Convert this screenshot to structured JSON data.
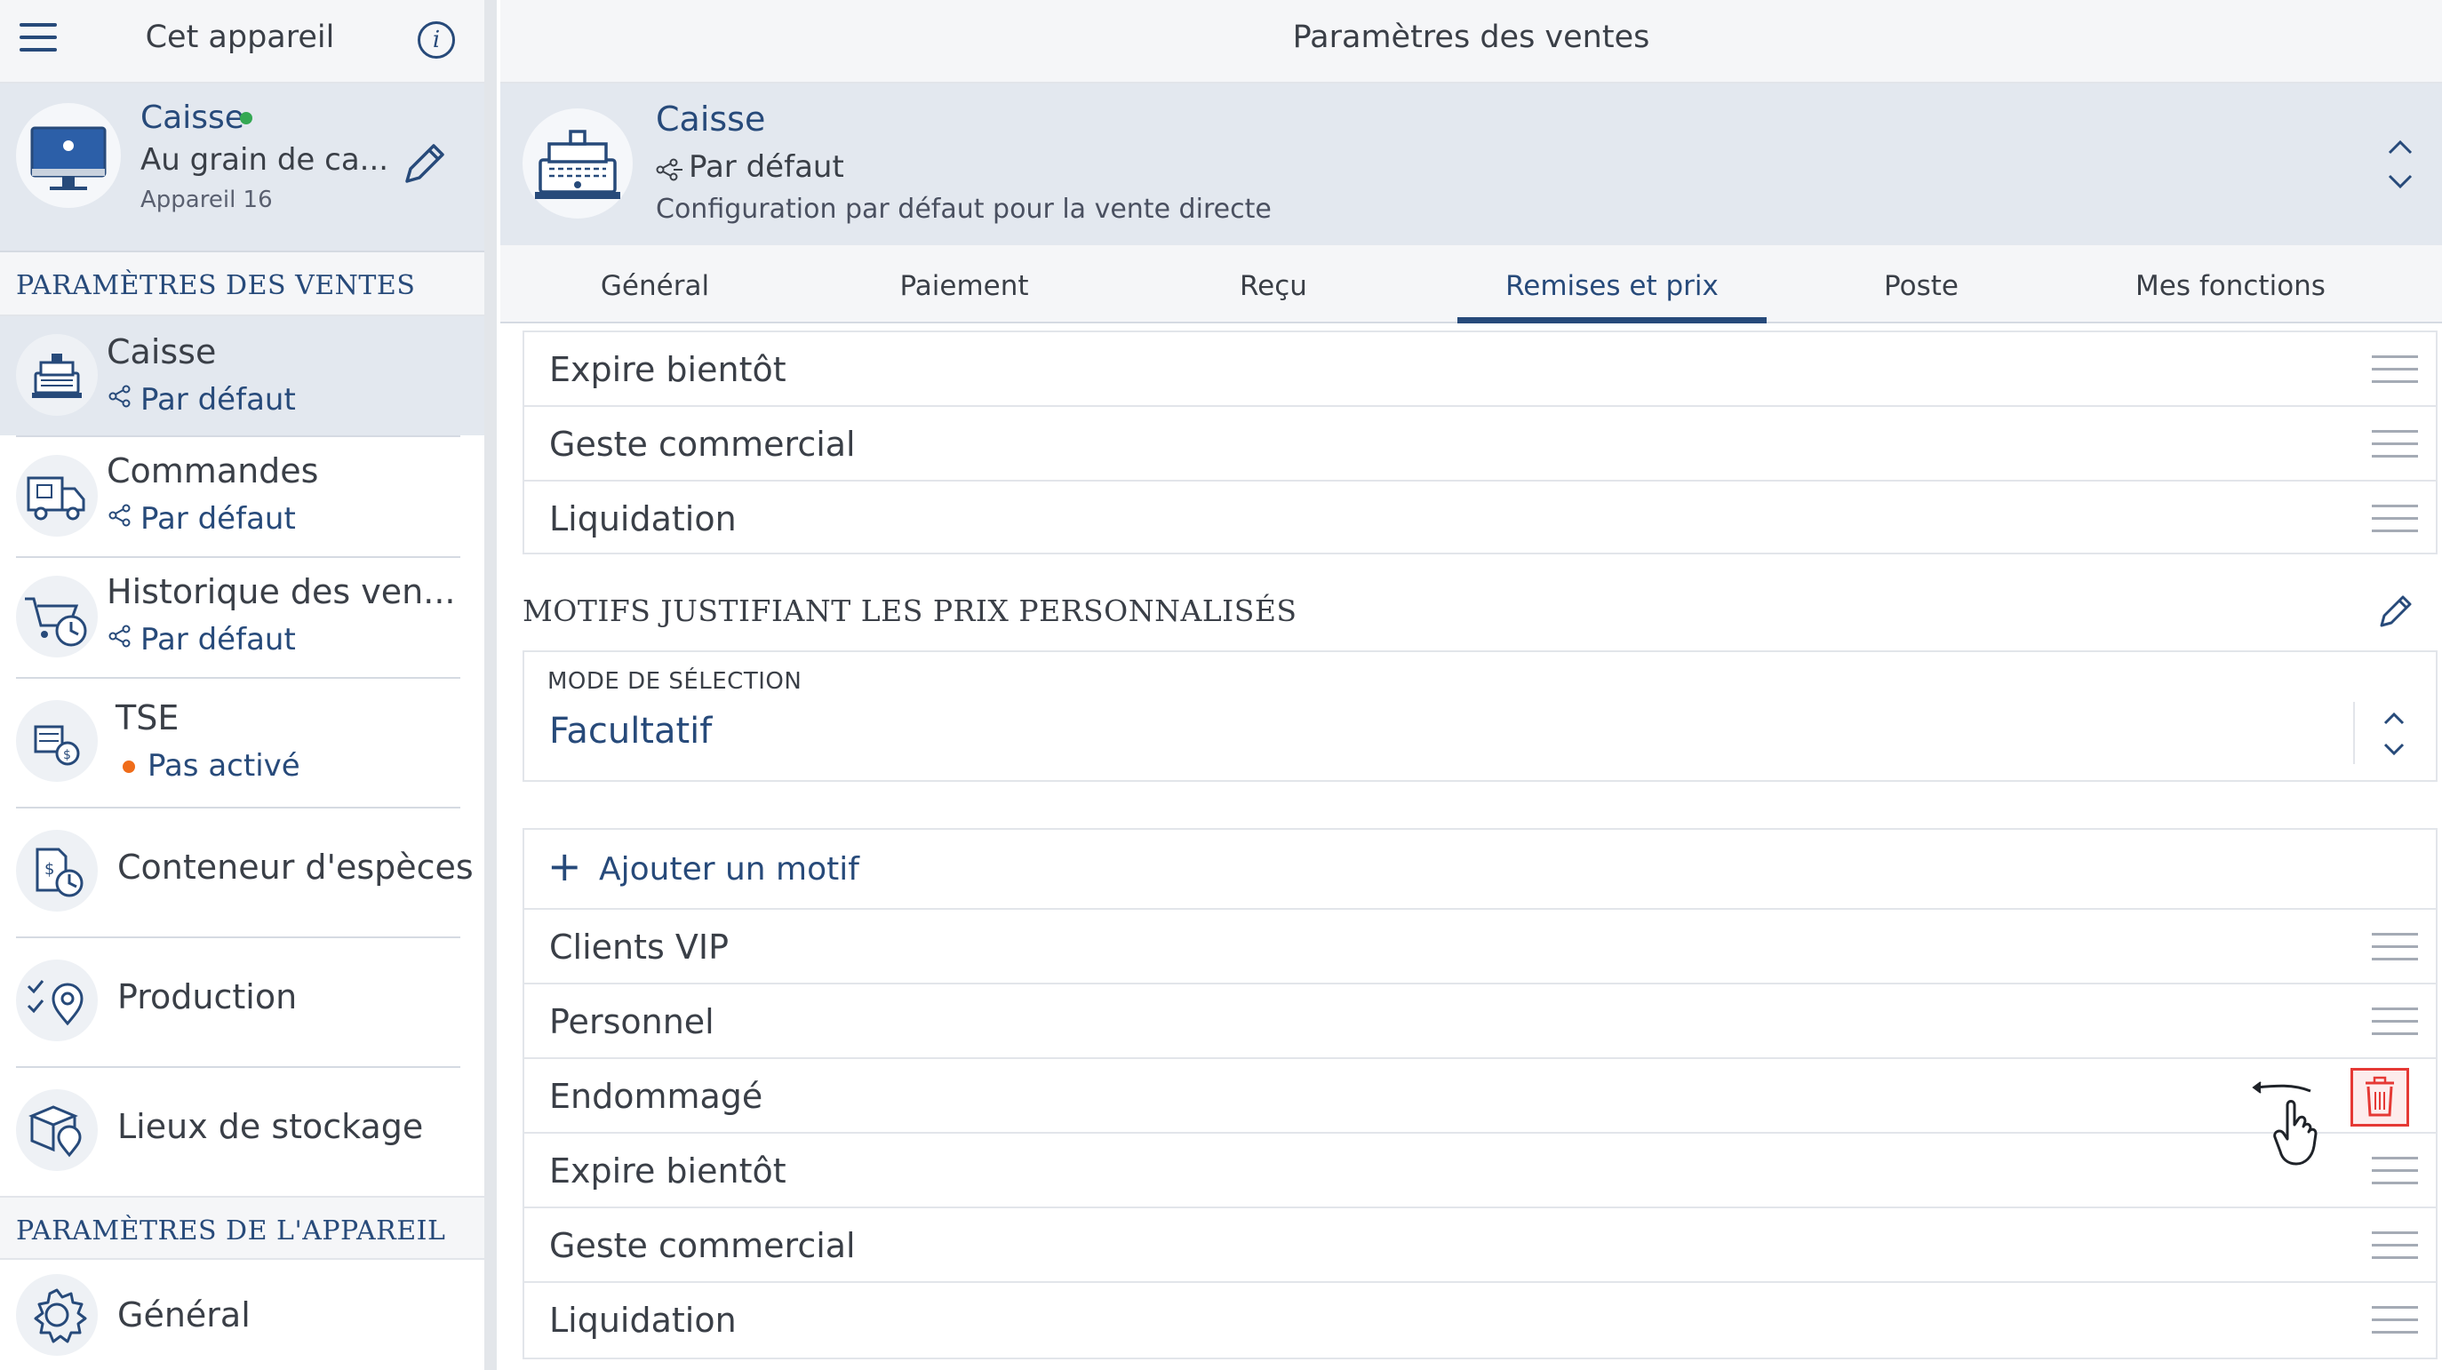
{
  "sidebar": {
    "title": "Cet appareil",
    "device": {
      "name": "Caisse",
      "store": "Au grain de ca...",
      "number": "Appareil 16",
      "status_color": "#34a853"
    },
    "sales_section_title": "PARAMÈTRES DES VENTES",
    "items": [
      {
        "label": "Caisse",
        "sublabel": "Par défaut",
        "icon": "cash-register-icon",
        "selected": true
      },
      {
        "label": "Commandes",
        "sublabel": "Par défaut",
        "icon": "delivery-truck-icon"
      },
      {
        "label": "Historique des ven...",
        "sublabel": "Par défaut",
        "icon": "cart-history-icon"
      },
      {
        "label": "TSE",
        "sublabel": "Pas activé",
        "icon": "tse-icon",
        "status_color": "#ef6c1a"
      },
      {
        "label": "Conteneur d'espèces",
        "icon": "cash-container-icon"
      },
      {
        "label": "Production",
        "icon": "production-icon"
      },
      {
        "label": "Lieux de stockage",
        "icon": "storage-locations-icon"
      }
    ],
    "device_section_title": "PARAMÈTRES DE L'APPAREIL",
    "device_items": [
      {
        "label": "Général",
        "icon": "gear-icon"
      }
    ]
  },
  "main": {
    "title": "Paramètres des ventes",
    "config": {
      "name": "Caisse",
      "mode": "Par défaut",
      "description": "Configuration par défaut pour la vente directe"
    },
    "tabs": [
      {
        "label": "Général"
      },
      {
        "label": "Paiement"
      },
      {
        "label": "Reçu"
      },
      {
        "label": "Remises et prix",
        "active": true
      },
      {
        "label": "Poste"
      },
      {
        "label": "Mes fonctions"
      }
    ],
    "top_list": [
      "Expire bientôt",
      "Geste commercial",
      "Liquidation"
    ],
    "price_reasons": {
      "title": "MOTIFS JUSTIFIANT LES PRIX PERSONNALISÉS",
      "mode_label": "MODE DE SÉLECTION",
      "mode_value": "Facultatif",
      "add_label": "Ajouter un motif",
      "items": [
        "Clients VIP",
        "Personnel",
        "Endommagé",
        "Expire bientôt",
        "Geste commercial",
        "Liquidation"
      ]
    }
  },
  "colors": {
    "accent": "#274a7a",
    "delete": "#e53935",
    "selected_bg": "#e3e8ef"
  }
}
